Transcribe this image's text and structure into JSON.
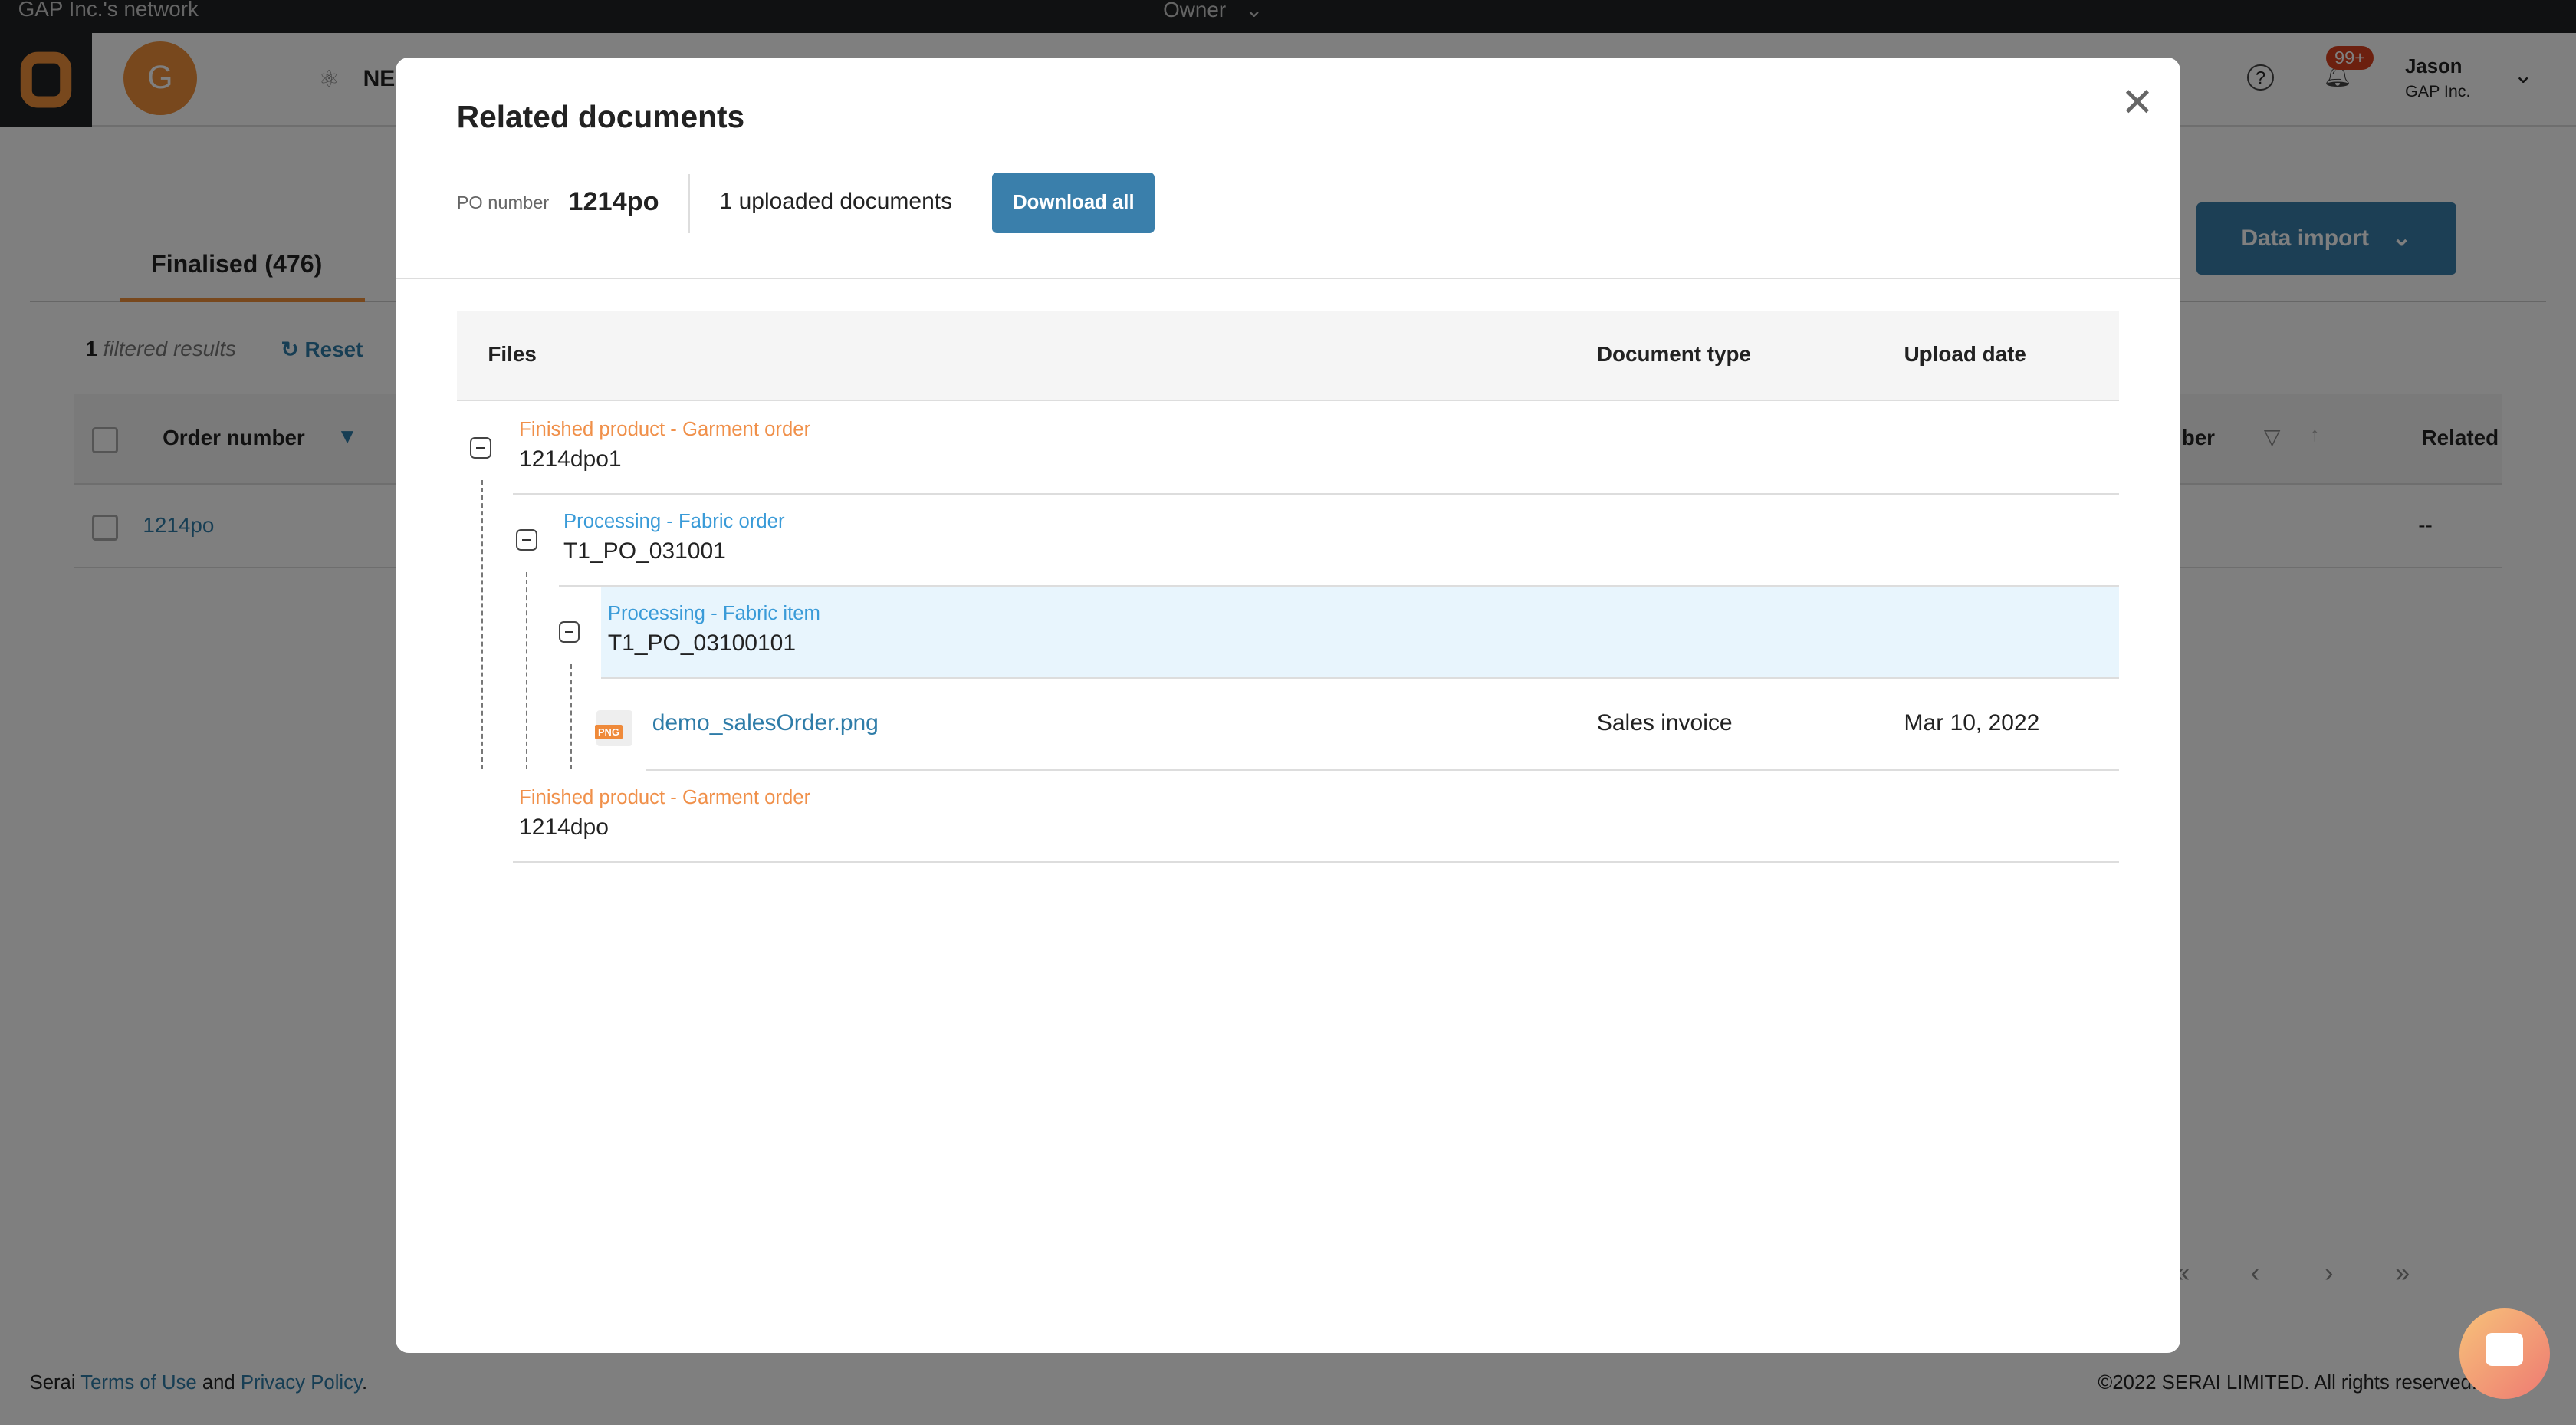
{
  "topbar": {
    "network": "GAP Inc.'s network",
    "role": "Owner"
  },
  "header": {
    "avatar_letter": "G",
    "nav_label": "NE",
    "user_name": "Jason",
    "user_org": "GAP Inc.",
    "notification_count": "99+"
  },
  "page": {
    "tab": "Finalised (476)",
    "filtered_count": "1",
    "filtered_label": "filtered results",
    "reset": "Reset",
    "data_import": "Data import",
    "columns": {
      "order_number": "Order number",
      "partial": "ber",
      "related": "Related"
    },
    "rows": [
      {
        "order_number": "1214po",
        "related": "--"
      }
    ]
  },
  "footer": {
    "brand": "Serai",
    "terms": "Terms of Use",
    "and": "and",
    "privacy": "Privacy Policy",
    "period": ".",
    "copyright": "©2022 SERAI LIMITED. All rights reserved."
  },
  "modal": {
    "title": "Related documents",
    "po_label": "PO number",
    "po_value": "1214po",
    "uploaded": "1 uploaded documents",
    "download_all": "Download all",
    "columns": {
      "files": "Files",
      "doc_type": "Document type",
      "upload_date": "Upload date"
    },
    "tree": [
      {
        "category": "Finished product - Garment order",
        "code": "1214dpo1"
      },
      {
        "category": "Processing - Fabric order",
        "code": "T1_PO_031001"
      },
      {
        "category": "Processing - Fabric item",
        "code": "T1_PO_03100101"
      },
      {
        "file": "demo_salesOrder.png",
        "file_badge": "PNG",
        "doc_type": "Sales invoice",
        "upload_date": "Mar 10, 2022"
      },
      {
        "category": "Finished product - Garment order",
        "code": "1214dpo"
      }
    ]
  },
  "colors": {
    "garment": "#f0904a",
    "fabric": "#3a9bd8",
    "link": "#2e7ca8",
    "highlight": "#e8f5fd",
    "accent": "#3a7fab",
    "badge": "#d9401e"
  }
}
